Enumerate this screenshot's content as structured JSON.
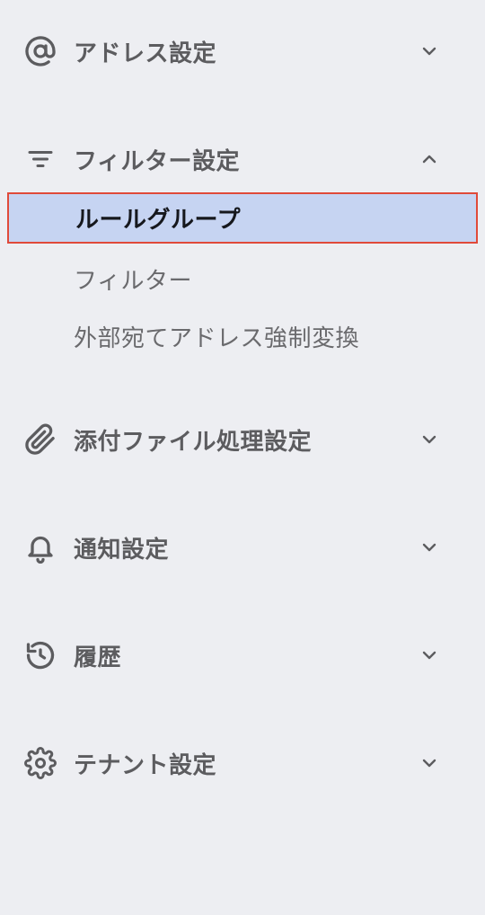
{
  "sections": [
    {
      "label": "アドレス設定",
      "icon": "at-sign-icon",
      "expanded": false
    },
    {
      "label": "フィルター設定",
      "icon": "filter-icon",
      "expanded": true,
      "items": [
        {
          "label": "ルールグループ",
          "active": true
        },
        {
          "label": "フィルター",
          "active": false
        },
        {
          "label": "外部宛てアドレス強制変換",
          "active": false
        }
      ]
    },
    {
      "label": "添付ファイル処理設定",
      "icon": "paperclip-icon",
      "expanded": false
    },
    {
      "label": "通知設定",
      "icon": "bell-icon",
      "expanded": false
    },
    {
      "label": "履歴",
      "icon": "history-icon",
      "expanded": false
    },
    {
      "label": "テナント設定",
      "icon": "gear-icon",
      "expanded": false
    }
  ],
  "colors": {
    "background": "#edeef2",
    "active_background": "#c6d4f2",
    "active_outline": "#e04a3a",
    "text": "#5c5c5f",
    "active_text": "#16181d"
  }
}
